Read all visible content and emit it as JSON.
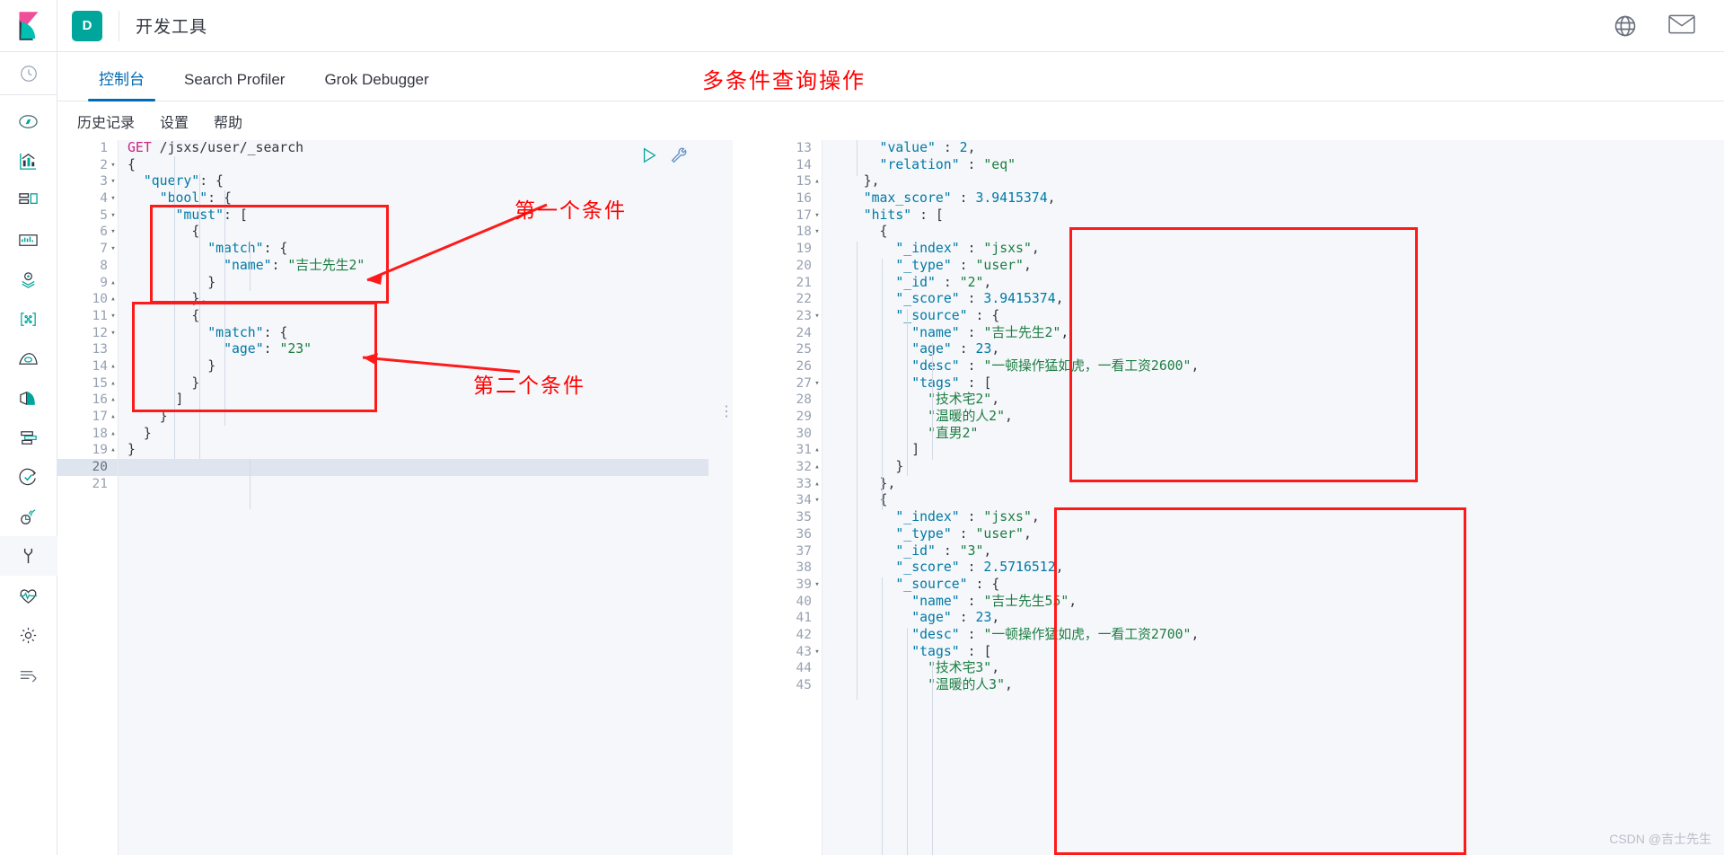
{
  "header": {
    "logo_name": "kibana-logo",
    "app_badge": "D",
    "app_title": "开发工具",
    "icons": [
      {
        "name": "help-globe-icon"
      },
      {
        "name": "mail-icon"
      }
    ]
  },
  "rail": {
    "items": [
      {
        "name": "recently-viewed-icon",
        "label": "最近访问"
      },
      {
        "name": "discover-compass-icon",
        "label": "Discover"
      },
      {
        "name": "visualize-chart-icon",
        "label": "Visualize"
      },
      {
        "name": "dashboard-icon",
        "label": "Dashboard"
      },
      {
        "name": "canvas-icon",
        "label": "Canvas"
      },
      {
        "name": "maps-icon",
        "label": "Maps"
      },
      {
        "name": "machine-learning-icon",
        "label": "Machine Learning"
      },
      {
        "name": "infrastructure-icon",
        "label": "Infrastructure"
      },
      {
        "name": "logs-icon",
        "label": "Logs"
      },
      {
        "name": "apm-icon",
        "label": "APM"
      },
      {
        "name": "uptime-icon",
        "label": "Uptime"
      },
      {
        "name": "siem-icon",
        "label": "SIEM"
      },
      {
        "name": "dev-tools-wrench-icon",
        "label": "开发工具"
      },
      {
        "name": "monitoring-icon",
        "label": "Monitoring"
      },
      {
        "name": "management-gear-icon",
        "label": "Management"
      },
      {
        "name": "collapse-arrow-icon",
        "label": "折叠"
      }
    ]
  },
  "tabs": {
    "items": [
      {
        "label": "控制台",
        "active": true
      },
      {
        "label": "Search Profiler",
        "active": false
      },
      {
        "label": "Grok Debugger",
        "active": false
      }
    ],
    "annotation": "多条件查询操作"
  },
  "console_toolbar": {
    "links": [
      "历史记录",
      "设置",
      "帮助"
    ]
  },
  "annotations": {
    "condition_one": "第一个条件",
    "condition_two": "第二个条件",
    "accent_color": "#ff1a1a",
    "text_color": "#ff0000"
  },
  "request_editor": {
    "name": "console-request-editor",
    "current_line": 20,
    "total_lines": 21,
    "lines": [
      {
        "n": 1,
        "fold": "",
        "text": "GET /jsxs/user/_search",
        "kind": "request"
      },
      {
        "n": 2,
        "fold": "▾",
        "text": "{"
      },
      {
        "n": 3,
        "fold": "▾",
        "text": "  \"query\": {"
      },
      {
        "n": 4,
        "fold": "▾",
        "text": "    \"bool\": {"
      },
      {
        "n": 5,
        "fold": "▾",
        "text": "      \"must\": ["
      },
      {
        "n": 6,
        "fold": "▾",
        "text": "        {"
      },
      {
        "n": 7,
        "fold": "▾",
        "text": "          \"match\": {"
      },
      {
        "n": 8,
        "fold": "",
        "text": "            \"name\": \"吉士先生2\""
      },
      {
        "n": 9,
        "fold": "▴",
        "text": "          }"
      },
      {
        "n": 10,
        "fold": "▴",
        "text": "        },"
      },
      {
        "n": 11,
        "fold": "▾",
        "text": "        {"
      },
      {
        "n": 12,
        "fold": "▾",
        "text": "          \"match\": {"
      },
      {
        "n": 13,
        "fold": "",
        "text": "            \"age\": \"23\""
      },
      {
        "n": 14,
        "fold": "▴",
        "text": "          }"
      },
      {
        "n": 15,
        "fold": "▴",
        "text": "        }"
      },
      {
        "n": 16,
        "fold": "▴",
        "text": "      ]"
      },
      {
        "n": 17,
        "fold": "▴",
        "text": "    }"
      },
      {
        "n": 18,
        "fold": "▴",
        "text": "  }"
      },
      {
        "n": 19,
        "fold": "▴",
        "text": "}"
      },
      {
        "n": 20,
        "fold": "",
        "text": ""
      },
      {
        "n": 21,
        "fold": "",
        "text": ""
      }
    ],
    "actions": [
      {
        "name": "send-request-play-icon"
      },
      {
        "name": "wrench-menu-icon"
      }
    ]
  },
  "response_editor": {
    "name": "console-response-editor",
    "first_visible_line": 13,
    "lines": [
      {
        "n": 13,
        "fold": "",
        "text": "      \"value\" : 2,"
      },
      {
        "n": 14,
        "fold": "",
        "text": "      \"relation\" : \"eq\""
      },
      {
        "n": 15,
        "fold": "▴",
        "text": "    },"
      },
      {
        "n": 16,
        "fold": "",
        "text": "    \"max_score\" : 3.9415374,"
      },
      {
        "n": 17,
        "fold": "▾",
        "text": "    \"hits\" : ["
      },
      {
        "n": 18,
        "fold": "▾",
        "text": "      {"
      },
      {
        "n": 19,
        "fold": "",
        "text": "        \"_index\" : \"jsxs\","
      },
      {
        "n": 20,
        "fold": "",
        "text": "        \"_type\" : \"user\","
      },
      {
        "n": 21,
        "fold": "",
        "text": "        \"_id\" : \"2\","
      },
      {
        "n": 22,
        "fold": "",
        "text": "        \"_score\" : 3.9415374,"
      },
      {
        "n": 23,
        "fold": "▾",
        "text": "        \"_source\" : {"
      },
      {
        "n": 24,
        "fold": "",
        "text": "          \"name\" : \"吉士先生2\","
      },
      {
        "n": 25,
        "fold": "",
        "text": "          \"age\" : 23,"
      },
      {
        "n": 26,
        "fold": "",
        "text": "          \"desc\" : \"一顿操作猛如虎，一看工资2600\","
      },
      {
        "n": 27,
        "fold": "▾",
        "text": "          \"tags\" : ["
      },
      {
        "n": 28,
        "fold": "",
        "text": "            \"技术宅2\","
      },
      {
        "n": 29,
        "fold": "",
        "text": "            \"温暖的人2\","
      },
      {
        "n": 30,
        "fold": "",
        "text": "            \"直男2\""
      },
      {
        "n": 31,
        "fold": "▴",
        "text": "          ]"
      },
      {
        "n": 32,
        "fold": "▴",
        "text": "        }"
      },
      {
        "n": 33,
        "fold": "▴",
        "text": "      },"
      },
      {
        "n": 34,
        "fold": "▾",
        "text": "      {"
      },
      {
        "n": 35,
        "fold": "",
        "text": "        \"_index\" : \"jsxs\","
      },
      {
        "n": 36,
        "fold": "",
        "text": "        \"_type\" : \"user\","
      },
      {
        "n": 37,
        "fold": "",
        "text": "        \"_id\" : \"3\","
      },
      {
        "n": 38,
        "fold": "",
        "text": "        \"_score\" : 2.5716512,"
      },
      {
        "n": 39,
        "fold": "▾",
        "text": "        \"_source\" : {"
      },
      {
        "n": 40,
        "fold": "",
        "text": "          \"name\" : \"吉士先生55\","
      },
      {
        "n": 41,
        "fold": "",
        "text": "          \"age\" : 23,"
      },
      {
        "n": 42,
        "fold": "",
        "text": "          \"desc\" : \"一顿操作猛如虎，一看工资2700\","
      },
      {
        "n": 43,
        "fold": "▾",
        "text": "          \"tags\" : ["
      },
      {
        "n": 44,
        "fold": "",
        "text": "            \"技术宅3\","
      },
      {
        "n": 45,
        "fold": "",
        "text": "            \"温暖的人3\","
      }
    ]
  },
  "watermark": "CSDN @吉士先生"
}
